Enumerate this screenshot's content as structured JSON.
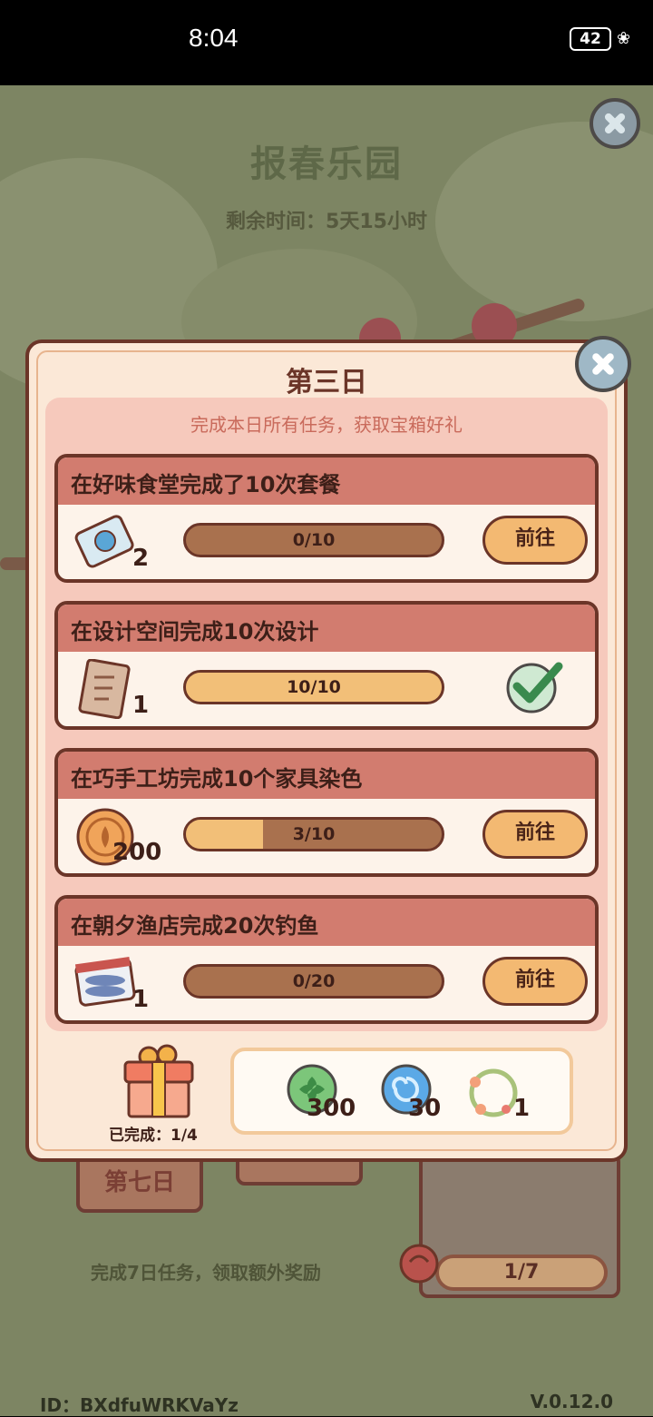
{
  "status_bar": {
    "time": "8:04",
    "battery": "42"
  },
  "page": {
    "title": "报春乐园",
    "remaining_time": "剩余时间：5天15小时",
    "behind_tab_label": "第七日",
    "bottom_hint": "完成7日任务，领取额外奖励",
    "progress_7": "1/7",
    "footer_id": "ID：BXdfuWRKVaYz",
    "footer_version": "V.0.12.0"
  },
  "modal": {
    "title": "第三日",
    "subtitle": "完成本日所有任务，获取宝箱好礼",
    "tasks": [
      {
        "title": "在好味食堂完成了10次套餐",
        "icon": "ticket-icon",
        "reward_count": "2",
        "progress_text": "0/10",
        "progress": 0.0,
        "action": "前往",
        "done": false
      },
      {
        "title": "在设计空间完成10次设计",
        "icon": "blueprint-scroll-icon",
        "reward_count": "1",
        "progress_text": "10/10",
        "progress": 1.0,
        "action": "",
        "done": true
      },
      {
        "title": "在巧手工坊完成10个家具染色",
        "icon": "gold-coin-icon",
        "reward_count": "200",
        "progress_text": "3/10",
        "progress": 0.3,
        "action": "前往",
        "done": false
      },
      {
        "title": "在朝夕渔店完成20次钓鱼",
        "icon": "fish-box-icon",
        "reward_count": "1",
        "progress_text": "0/20",
        "progress": 0.0,
        "action": "前往",
        "done": false
      }
    ],
    "chest": {
      "completed_label": "已完成：1/4"
    },
    "rewards": [
      {
        "icon": "clover-token-icon",
        "count": "300"
      },
      {
        "icon": "blue-swirl-orb-icon",
        "count": "30"
      },
      {
        "icon": "flower-wreath-icon",
        "count": "1"
      }
    ]
  },
  "colors": {
    "header": "#d27c6f",
    "border": "#6b3528",
    "bar_fill": "#f2bf78",
    "button": "#f3b972"
  }
}
